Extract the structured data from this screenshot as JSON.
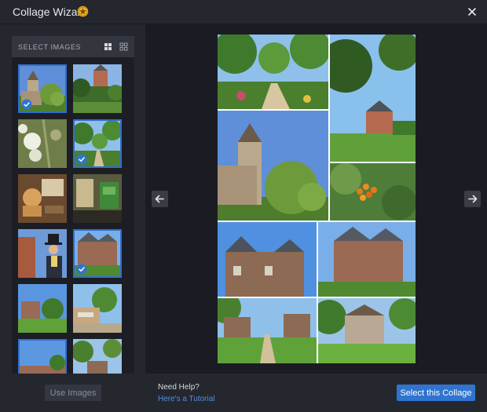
{
  "window": {
    "title": "Collage Wizard",
    "title_icon": "star-badge-icon",
    "close_icon": "close-icon"
  },
  "sidebar": {
    "header": "SELECT IMAGES",
    "view_icons": [
      "grid-large-icon",
      "grid-small-icon"
    ],
    "thumbnails": [
      {
        "name": "church-tower",
        "selected": true
      },
      {
        "name": "castle-garden",
        "selected": false
      },
      {
        "name": "white-roses",
        "selected": false
      },
      {
        "name": "garden-path",
        "selected": true
      },
      {
        "name": "lion-statue-room",
        "selected": false
      },
      {
        "name": "green-interior",
        "selected": false
      },
      {
        "name": "top-hat-figure",
        "selected": false
      },
      {
        "name": "castle-front",
        "selected": true
      },
      {
        "name": "castle-lawn",
        "selected": false
      },
      {
        "name": "market-square",
        "selected": false
      },
      {
        "name": "castle-blue-sky",
        "selected": true
      },
      {
        "name": "castle-trees",
        "selected": false
      }
    ],
    "use_button": "Use Images"
  },
  "preview": {
    "prev_icon": "arrow-left-icon",
    "next_icon": "arrow-right-icon"
  },
  "footer": {
    "help_title": "Need Help?",
    "help_link": "Here's a Tutorial",
    "select_button": "Select this Collage"
  },
  "colors": {
    "accent": "#2f74cf",
    "link": "#4d8fe4",
    "background": "#25272f",
    "panel": "#1d1e25"
  }
}
